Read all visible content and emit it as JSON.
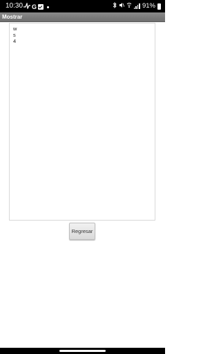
{
  "status_bar": {
    "time": "10:30",
    "battery": "91%",
    "battery_level": 0.91,
    "left_icons": [
      "activity-icon",
      "google-icon",
      "check-app-icon",
      "notification-dot-icon"
    ],
    "right_icons": [
      "bluetooth-icon",
      "mute-icon",
      "wifi-calling-icon",
      "signal-icon",
      "battery-icon"
    ]
  },
  "app_bar": {
    "title": "Mostrar"
  },
  "text_area": {
    "lines": [
      "w",
      "s",
      "4"
    ]
  },
  "buttons": {
    "back_label": "Regresar"
  },
  "colors": {
    "status_bar_bg": "#000000",
    "app_bar_bg": "#7a7a7a",
    "button_bg": "#e4e4e4"
  }
}
